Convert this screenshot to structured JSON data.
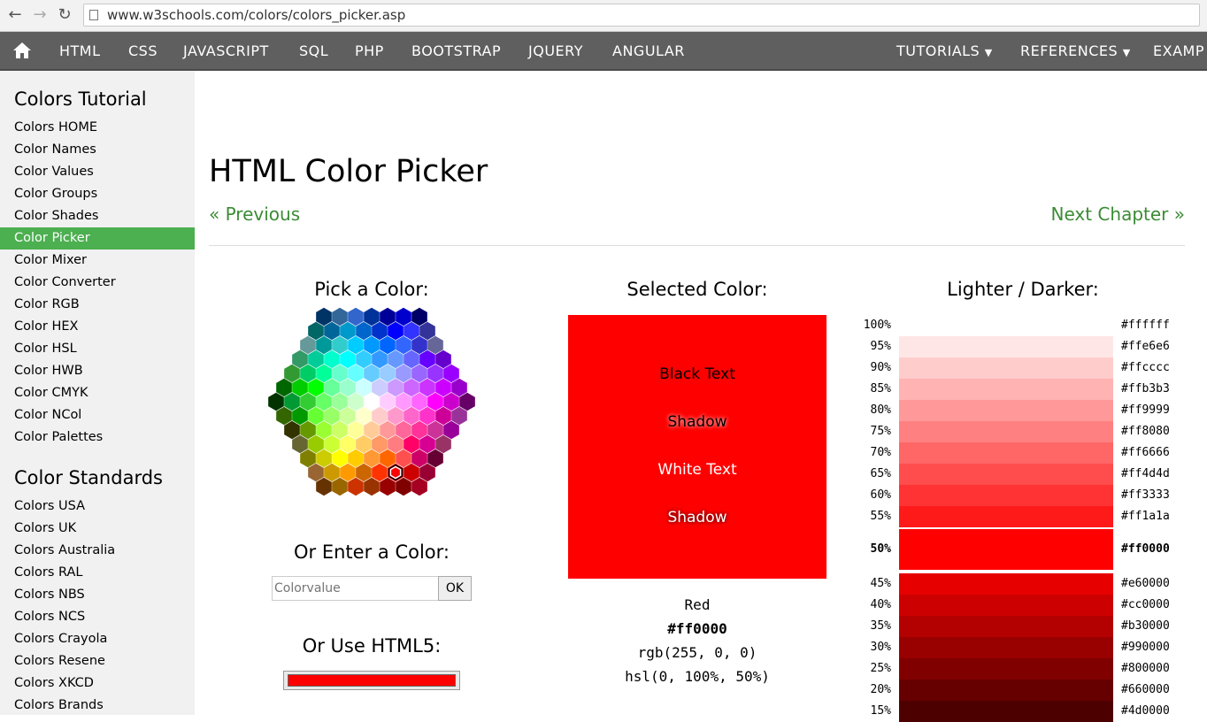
{
  "browser": {
    "back_icon": "back-arrow-icon",
    "forward_icon": "forward-arrow-icon",
    "reload_icon": "reload-icon",
    "url": "www.w3schools.com/colors/colors_picker.asp"
  },
  "topnav": {
    "home_icon": "home-icon",
    "items": [
      "HTML",
      "CSS",
      "JAVASCRIPT",
      "SQL",
      "PHP",
      "BOOTSTRAP",
      "JQUERY",
      "ANGULAR"
    ],
    "right_items": [
      "TUTORIALS",
      "REFERENCES",
      "EXAMP"
    ]
  },
  "sidebar": {
    "heading1": "Colors Tutorial",
    "tutorial_links": [
      "Colors HOME",
      "Color Names",
      "Color Values",
      "Color Groups",
      "Color Shades",
      "Color Picker",
      "Color Mixer",
      "Color Converter",
      "Color RGB",
      "Color HEX",
      "Color HSL",
      "Color HWB",
      "Color CMYK",
      "Color NCol",
      "Color Palettes"
    ],
    "active": "Color Picker",
    "heading2": "Color Standards",
    "standard_links": [
      "Colors USA",
      "Colors UK",
      "Colors Australia",
      "Colors RAL",
      "Colors NBS",
      "Colors NCS",
      "Colors Crayola",
      "Colors Resene",
      "Colors XKCD",
      "Colors Brands"
    ]
  },
  "main": {
    "title": "HTML Color Picker",
    "previous": "« Previous",
    "next": "Next Chapter »",
    "pick_title": "Pick a Color:",
    "enter_title": "Or Enter a Color:",
    "input_placeholder": "Colorvalue",
    "ok_label": "OK",
    "html5_title": "Or Use HTML5:",
    "html5_value": "#ff0000",
    "selected_title": "Selected Color:",
    "selected_color": "#ff0000",
    "sample_texts": [
      "Black Text",
      "Shadow",
      "White Text",
      "Shadow"
    ],
    "color_name": "Red",
    "hex": "#ff0000",
    "rgb": "rgb(255, 0, 0)",
    "hsl": "hsl(0, 100%, 50%)",
    "shades_title": "Lighter / Darker:",
    "shades": [
      {
        "pct": "100%",
        "hex": "#ffffff"
      },
      {
        "pct": "95%",
        "hex": "#ffe6e6"
      },
      {
        "pct": "90%",
        "hex": "#ffcccc"
      },
      {
        "pct": "85%",
        "hex": "#ffb3b3"
      },
      {
        "pct": "80%",
        "hex": "#ff9999"
      },
      {
        "pct": "75%",
        "hex": "#ff8080"
      },
      {
        "pct": "70%",
        "hex": "#ff6666"
      },
      {
        "pct": "65%",
        "hex": "#ff4d4d"
      },
      {
        "pct": "60%",
        "hex": "#ff3333"
      },
      {
        "pct": "55%",
        "hex": "#ff1a1a"
      },
      {
        "pct": "50%",
        "hex": "#ff0000"
      },
      {
        "pct": "45%",
        "hex": "#e60000"
      },
      {
        "pct": "40%",
        "hex": "#cc0000"
      },
      {
        "pct": "35%",
        "hex": "#b30000"
      },
      {
        "pct": "30%",
        "hex": "#990000"
      },
      {
        "pct": "25%",
        "hex": "#800000"
      },
      {
        "pct": "20%",
        "hex": "#660000"
      },
      {
        "pct": "15%",
        "hex": "#4d0000"
      }
    ],
    "hex_colors": [
      [
        "#003366",
        "#336699",
        "#3366CC",
        "#003399",
        "#000099",
        "#0000CC",
        "#000066"
      ],
      [
        "#006666",
        "#006699",
        "#0099CC",
        "#0066CC",
        "#0033CC",
        "#0000FF",
        "#3333FF",
        "#333399"
      ],
      [
        "#669999",
        "#009999",
        "#33CCCC",
        "#00CCFF",
        "#0099FF",
        "#0066FF",
        "#3366FF",
        "#3333CC",
        "#666699"
      ],
      [
        "#339966",
        "#00CC99",
        "#00FFCC",
        "#00FFFF",
        "#33CCFF",
        "#3399FF",
        "#6699FF",
        "#6666FF",
        "#6600FF",
        "#6600CC"
      ],
      [
        "#339933",
        "#00CC66",
        "#00FF99",
        "#66FFCC",
        "#66FFFF",
        "#66CCFF",
        "#99CCFF",
        "#9999FF",
        "#9966FF",
        "#9933FF",
        "#9900FF"
      ],
      [
        "#006600",
        "#00CC00",
        "#00FF00",
        "#66FF99",
        "#99FFCC",
        "#CCFFFF",
        "#CCCCFF",
        "#CC99FF",
        "#CC66FF",
        "#CC33FF",
        "#CC00FF",
        "#9900CC"
      ],
      [
        "#003300",
        "#009933",
        "#33CC33",
        "#66FF66",
        "#99FF99",
        "#CCFFCC",
        "#FFFFFF",
        "#FFCCFF",
        "#FF99FF",
        "#FF66FF",
        "#FF00FF",
        "#CC00CC",
        "#660066"
      ],
      [
        "#336600",
        "#009900",
        "#66FF33",
        "#99FF66",
        "#CCFF99",
        "#FFFFCC",
        "#FFCCCC",
        "#FF99CC",
        "#FF66CC",
        "#FF33CC",
        "#CC0099",
        "#993399"
      ],
      [
        "#333300",
        "#669900",
        "#99FF33",
        "#CCFF66",
        "#FFFF99",
        "#FFCC99",
        "#FF9999",
        "#FF6699",
        "#FF3399",
        "#CC3399",
        "#990099"
      ],
      [
        "#666633",
        "#99CC00",
        "#CCFF33",
        "#FFFF66",
        "#FFCC66",
        "#FF9966",
        "#FF7C80",
        "#FF0066",
        "#D60093",
        "#993366"
      ],
      [
        "#808000",
        "#CCCC00",
        "#FFFF00",
        "#FFCC00",
        "#FF9933",
        "#FF6600",
        "#FF5050",
        "#CC0066",
        "#660033"
      ],
      [
        "#996633",
        "#CC9900",
        "#FF9900",
        "#CC6600",
        "#FF3300",
        "#FF0000",
        "#CC0000",
        "#990033"
      ],
      [
        "#663300",
        "#996600",
        "#CC3300",
        "#993300",
        "#990000",
        "#800000",
        "#A50021"
      ]
    ]
  }
}
